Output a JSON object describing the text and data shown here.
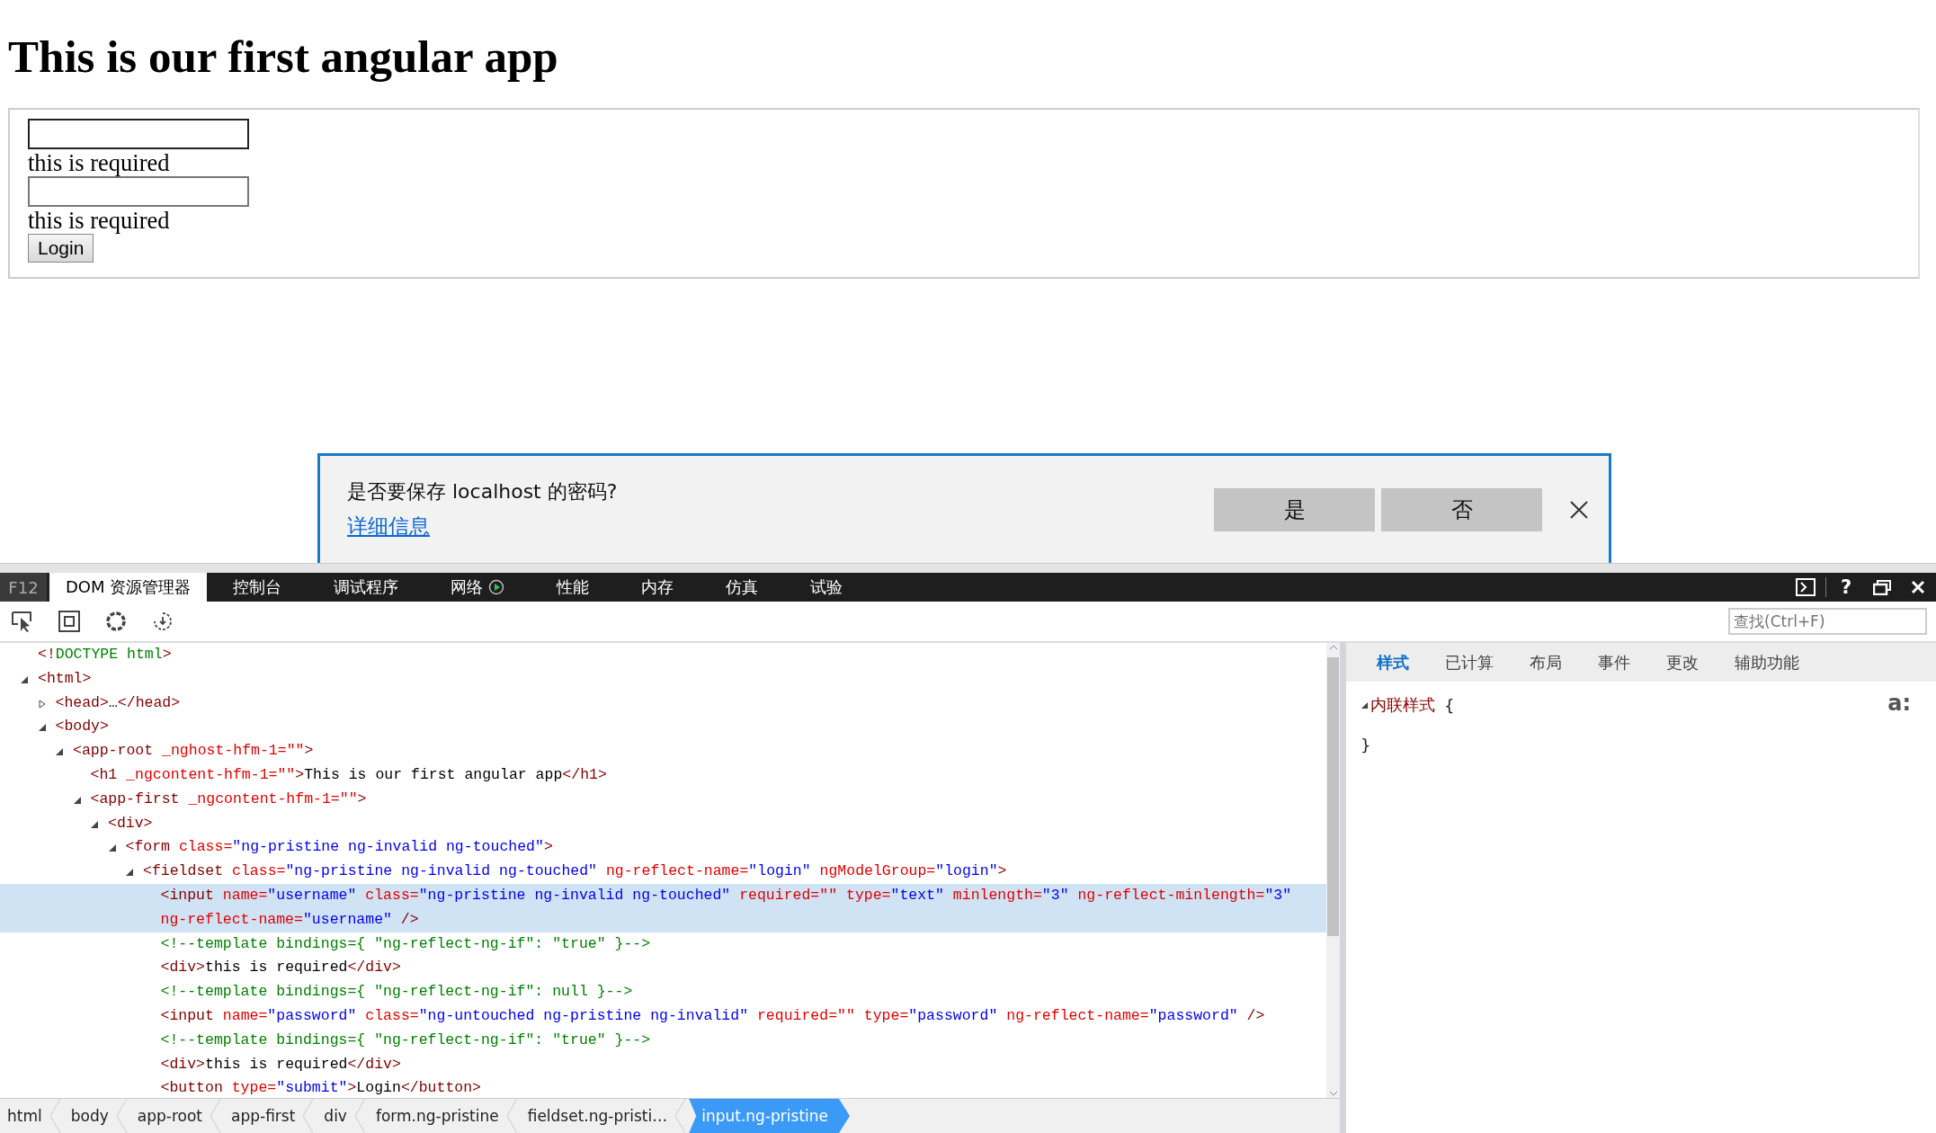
{
  "page": {
    "heading": "This is our first angular app",
    "form": {
      "fields": [
        {
          "error": "this is required"
        },
        {
          "error": "this is required"
        }
      ],
      "button": "Login"
    }
  },
  "dialog": {
    "message": "是否要保存 localhost 的密码?",
    "link": "详细信息",
    "buttons": [
      "是",
      "否"
    ]
  },
  "devtools": {
    "f12_label": "F12",
    "tabs": [
      {
        "label": "DOM 资源管理器",
        "selected": true,
        "kind": "text"
      },
      {
        "label": "控制台",
        "selected": false,
        "kind": "text"
      },
      {
        "label": "调试程序",
        "selected": false,
        "kind": "text"
      },
      {
        "label": "网络",
        "selected": false,
        "kind": "network"
      },
      {
        "label": "性能",
        "selected": false,
        "kind": "text"
      },
      {
        "label": "内存",
        "selected": false,
        "kind": "text"
      },
      {
        "label": "仿真",
        "selected": false,
        "kind": "text"
      },
      {
        "label": "试验",
        "selected": false,
        "kind": "text"
      }
    ],
    "help_button": "?",
    "search": {
      "placeholder": "查找(Ctrl+F)"
    },
    "dom_tree": [
      {
        "selected": false,
        "tokens": [
          {
            "kind": "tag",
            "text": "<!"
          },
          {
            "kind": "comment",
            "text": "DOCTYPE html"
          },
          {
            "kind": "tag",
            "text": ">"
          }
        ]
      },
      {
        "selected": false,
        "expanded": true,
        "tokens": [
          {
            "kind": "tag",
            "text": "<html>"
          }
        ],
        "children": [
          {
            "selected": false,
            "expanded": false,
            "tokens": [
              {
                "kind": "tag",
                "text": "<head>"
              },
              {
                "kind": "text",
                "text": "…"
              },
              {
                "kind": "tag",
                "text": "</head>"
              }
            ]
          },
          {
            "selected": false,
            "expanded": true,
            "tokens": [
              {
                "kind": "tag",
                "text": "<body>"
              }
            ],
            "children": [
              {
                "selected": false,
                "expanded": true,
                "tokens": [
                  {
                    "kind": "tag",
                    "text": "<app-root"
                  },
                  {
                    "kind": "attr",
                    "text": " _nghost-hfm-1=\"\""
                  },
                  {
                    "kind": "tag",
                    "text": ">"
                  }
                ],
                "children": [
                  {
                    "selected": false,
                    "tokens": [
                      {
                        "kind": "tag",
                        "text": "<h1"
                      },
                      {
                        "kind": "attr",
                        "text": " _ngcontent-hfm-1=\"\""
                      },
                      {
                        "kind": "tag",
                        "text": ">"
                      },
                      {
                        "kind": "text",
                        "text": "This is our first angular app"
                      },
                      {
                        "kind": "tag",
                        "text": "</h1>"
                      }
                    ]
                  },
                  {
                    "selected": false,
                    "expanded": true,
                    "tokens": [
                      {
                        "kind": "tag",
                        "text": "<app-first"
                      },
                      {
                        "kind": "attr",
                        "text": " _ngcontent-hfm-1=\"\""
                      },
                      {
                        "kind": "tag",
                        "text": ">"
                      }
                    ],
                    "children": [
                      {
                        "selected": false,
                        "expanded": true,
                        "tokens": [
                          {
                            "kind": "tag",
                            "text": "<div>"
                          }
                        ],
                        "children": [
                          {
                            "selected": false,
                            "expanded": true,
                            "tokens": [
                              {
                                "kind": "tag",
                                "text": "<form"
                              },
                              {
                                "kind": "attr",
                                "text": " class="
                              },
                              {
                                "kind": "value",
                                "text": "\"ng-pristine ng-invalid ng-touched\""
                              },
                              {
                                "kind": "tag",
                                "text": ">"
                              }
                            ],
                            "children": [
                              {
                                "selected": false,
                                "expanded": true,
                                "tokens": [
                                  {
                                    "kind": "tag",
                                    "text": "<fieldset"
                                  },
                                  {
                                    "kind": "attr",
                                    "text": " class="
                                  },
                                  {
                                    "kind": "value",
                                    "text": "\"ng-pristine ng-invalid ng-touched\""
                                  },
                                  {
                                    "kind": "attr",
                                    "text": " ng-reflect-name="
                                  },
                                  {
                                    "kind": "value",
                                    "text": "\"login\""
                                  },
                                  {
                                    "kind": "attr",
                                    "text": " ngModelGroup="
                                  },
                                  {
                                    "kind": "value",
                                    "text": "\"login\""
                                  },
                                  {
                                    "kind": "tag",
                                    "text": ">"
                                  }
                                ],
                                "children": [
                                  {
                                    "selected": true,
                                    "tokens": [
                                      {
                                        "kind": "tag",
                                        "text": "<input"
                                      },
                                      {
                                        "kind": "attr",
                                        "text": " name="
                                      },
                                      {
                                        "kind": "value",
                                        "text": "\"username\""
                                      },
                                      {
                                        "kind": "attr",
                                        "text": " class="
                                      },
                                      {
                                        "kind": "value",
                                        "text": "\"ng-pristine ng-invalid ng-touched\""
                                      },
                                      {
                                        "kind": "attr",
                                        "text": " required=\"\""
                                      },
                                      {
                                        "kind": "attr",
                                        "text": " type="
                                      },
                                      {
                                        "kind": "value",
                                        "text": "\"text\""
                                      },
                                      {
                                        "kind": "attr",
                                        "text": " minlength="
                                      },
                                      {
                                        "kind": "value",
                                        "text": "\"3\""
                                      },
                                      {
                                        "kind": "attr",
                                        "text": " ng-reflect-minlength="
                                      },
                                      {
                                        "kind": "value",
                                        "text": "\"3\""
                                      },
                                      {
                                        "kind": "attr",
                                        "text": " ng-reflect-name="
                                      },
                                      {
                                        "kind": "value",
                                        "text": "\"username\""
                                      },
                                      {
                                        "kind": "tag",
                                        "text": " />"
                                      }
                                    ]
                                  },
                                  {
                                    "selected": false,
                                    "tokens": [
                                      {
                                        "kind": "comment",
                                        "text": "<!--template bindings={ \"ng-reflect-ng-if\": \"true\" }-->"
                                      }
                                    ]
                                  },
                                  {
                                    "selected": false,
                                    "tokens": [
                                      {
                                        "kind": "tag",
                                        "text": "<div>"
                                      },
                                      {
                                        "kind": "text",
                                        "text": "this is required"
                                      },
                                      {
                                        "kind": "tag",
                                        "text": "</div>"
                                      }
                                    ]
                                  },
                                  {
                                    "selected": false,
                                    "tokens": [
                                      {
                                        "kind": "comment",
                                        "text": "<!--template bindings={ \"ng-reflect-ng-if\": null }-->"
                                      }
                                    ]
                                  },
                                  {
                                    "selected": false,
                                    "tokens": [
                                      {
                                        "kind": "tag",
                                        "text": "<input"
                                      },
                                      {
                                        "kind": "attr",
                                        "text": " name="
                                      },
                                      {
                                        "kind": "value",
                                        "text": "\"password\""
                                      },
                                      {
                                        "kind": "attr",
                                        "text": " class="
                                      },
                                      {
                                        "kind": "value",
                                        "text": "\"ng-untouched ng-pristine ng-invalid\""
                                      },
                                      {
                                        "kind": "attr",
                                        "text": " required=\"\""
                                      },
                                      {
                                        "kind": "attr",
                                        "text": " type="
                                      },
                                      {
                                        "kind": "value",
                                        "text": "\"password\""
                                      },
                                      {
                                        "kind": "attr",
                                        "text": " ng-reflect-name="
                                      },
                                      {
                                        "kind": "value",
                                        "text": "\"password\""
                                      },
                                      {
                                        "kind": "tag",
                                        "text": " />"
                                      }
                                    ]
                                  },
                                  {
                                    "selected": false,
                                    "tokens": [
                                      {
                                        "kind": "comment",
                                        "text": "<!--template bindings={ \"ng-reflect-ng-if\": \"true\" }-->"
                                      }
                                    ]
                                  },
                                  {
                                    "selected": false,
                                    "tokens": [
                                      {
                                        "kind": "tag",
                                        "text": "<div>"
                                      },
                                      {
                                        "kind": "text",
                                        "text": "this is required"
                                      },
                                      {
                                        "kind": "tag",
                                        "text": "</div>"
                                      }
                                    ]
                                  },
                                  {
                                    "selected": false,
                                    "tokens": [
                                      {
                                        "kind": "tag",
                                        "text": "<button"
                                      },
                                      {
                                        "kind": "attr",
                                        "text": " type="
                                      },
                                      {
                                        "kind": "value",
                                        "text": "\"submit\""
                                      },
                                      {
                                        "kind": "tag",
                                        "text": ">"
                                      },
                                      {
                                        "kind": "text",
                                        "text": "Login"
                                      },
                                      {
                                        "kind": "tag",
                                        "text": "</button>"
                                      }
                                    ]
                                  }
                                ]
                              }
                            ]
                          }
                        ]
                      }
                    ]
                  }
                ]
              }
            ]
          }
        ]
      }
    ],
    "breadcrumb": [
      {
        "label": "html",
        "selected": false
      },
      {
        "label": "body",
        "selected": false
      },
      {
        "label": "app-root",
        "selected": false
      },
      {
        "label": "app-first",
        "selected": false
      },
      {
        "label": "div",
        "selected": false
      },
      {
        "label": "form.ng-pristine",
        "selected": false
      },
      {
        "label": "fieldset.ng-pristi…",
        "selected": false
      },
      {
        "label": "input.ng-pristine",
        "selected": true
      }
    ],
    "styles_panel": {
      "tabs": [
        {
          "label": "样式",
          "selected": true
        },
        {
          "label": "已计算",
          "selected": false
        },
        {
          "label": "布局",
          "selected": false
        },
        {
          "label": "事件",
          "selected": false
        },
        {
          "label": "更改",
          "selected": false
        },
        {
          "label": "辅助功能",
          "selected": false
        }
      ],
      "pseudo_toggle": "a:",
      "rule": {
        "selector": "内联样式",
        "expanded": true,
        "open_brace": "{",
        "close_brace": "}"
      }
    }
  }
}
